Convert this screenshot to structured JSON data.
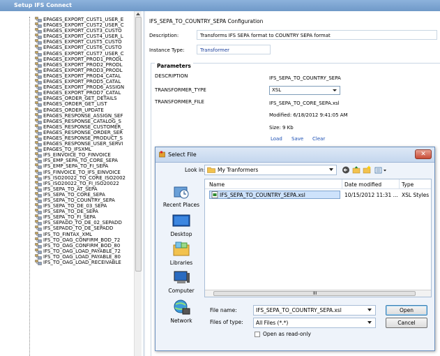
{
  "window": {
    "title": "Setup IFS Connect"
  },
  "tree": {
    "items": [
      "EPAGES_EXPORT_CUST1_USER_E",
      "EPAGES_EXPORT_CUST2_USER_C",
      "EPAGES_EXPORT_CUST3_CUSTO",
      "EPAGES_EXPORT_CUST4_USER_L",
      "EPAGES_EXPORT_CUST5_CUSTO",
      "EPAGES_EXPORT_CUST6_CUSTO",
      "EPAGES_EXPORT_CUST7_USER_C",
      "EPAGES_EXPORT_PROD1_PRODL",
      "EPAGES_EXPORT_PROD2_PRODL",
      "EPAGES_EXPORT_PROD3_PRODL",
      "EPAGES_EXPORT_PROD4_CATAL",
      "EPAGES_EXPORT_PROD5_CATAL",
      "EPAGES_EXPORT_PROD6_ASSIGN",
      "EPAGES_EXPORT_PROD7_CATAL",
      "EPAGES_ORDER_GET_DETAILS",
      "EPAGES_ORDER_GET_LIST",
      "EPAGES_ORDER_UPDATE",
      "EPAGES_RESPONSE_ASSIGN_SEF",
      "EPAGES_RESPONSE_CATALOG_S",
      "EPAGES_RESPONSE_CUSTOMER_",
      "EPAGES_RESPONSE_ORDER_SER",
      "EPAGES_RESPONSE_PRODUCT_S",
      "EPAGES_RESPONSE_USER_SERVI",
      "EPAGES_TO_IFSXML",
      "IFS_EINVOICE_TO_FINVOICE",
      "IFS_EMP_SEPA_TO_CORE_SEPA",
      "IFS_EMP_SEPA_TO_FI_SEPA",
      "IFS_FINVOICE_TO_IFS_EINVOICE",
      "IFS_ISO20022_TO_CORE_ISO2002",
      "IFS_ISO20022_TO_FI_ISO20022",
      "IFS_SEPA_TO_AT_SEPA",
      "IFS_SEPA_TO_CORE_SEPA",
      "IFS_SEPA_TO_COUNTRY_SEPA",
      "IFS_SEPA_TO_DE_03_SEPA",
      "IFS_SEPA_TO_DE_SEPA",
      "IFS_SEPA_TO_FI_SEPA",
      "IFS_SEPADD_TO_DE_02_SEPADD",
      "IFS_SEPADD_TO_DE_SEPADD",
      "IFS_TO_FINTAX_XML",
      "IFS_TO_OAG_CONFIRM_BOD_72",
      "IFS_TO_OAG_CONFIRM_BOD_80",
      "IFS_TO_OAG_LOAD_PAYABLE_72",
      "IFS_TO_OAG_LOAD_PAYABLE_80",
      "IFS_TO_OAG_LOAD_RECEIVABLE"
    ]
  },
  "config": {
    "title": "IFS_SEPA_TO_COUNTRY_SEPA Configuration",
    "description_label": "Description:",
    "description_value": "Transforms IFS SEPA format to COUNTRY SEPA format",
    "instance_type_label": "Instance Type:",
    "instance_type_value": "Transformer",
    "parameters_legend": "Parameters",
    "params": {
      "description_label": "DESCRIPTION",
      "description_value": "IFS_SEPA_TO_COUNTRY_SEPA",
      "type_label": "TRANSFORMER_TYPE",
      "type_value": "XSL",
      "file_label": "TRANSFORMER_FILE",
      "file_value": "IFS_SEPA_TO_CORE_SEPA.xsl",
      "modified": "Modified: 6/18/2012 9:41:05 AM",
      "size": "Size: 9 Kb",
      "load": "Load",
      "save": "Save",
      "clear": "Clear"
    }
  },
  "dialog": {
    "title": "Select File",
    "look_in_label": "Look in:",
    "look_in_value": "My Tranformers",
    "places": [
      "Recent Places",
      "Desktop",
      "Libraries",
      "Computer",
      "Network"
    ],
    "columns": {
      "name": "Name",
      "date": "Date modified",
      "type": "Type"
    },
    "files": [
      {
        "name": "IFS_SEPA_TO_COUNTRY_SEPA.xsl",
        "date": "10/15/2012 11:31 ...",
        "type": "XSL Styles"
      }
    ],
    "file_name_label": "File name:",
    "file_name_value": "IFS_SEPA_TO_COUNTRY_SEPA.xsl",
    "files_of_type_label": "Files of type:",
    "files_of_type_value": "All Files (*.*)",
    "read_only_label": "Open as read-only",
    "open_label": "Open",
    "cancel_label": "Cancel",
    "close_glyph": "✕",
    "scroll_center": "III"
  }
}
